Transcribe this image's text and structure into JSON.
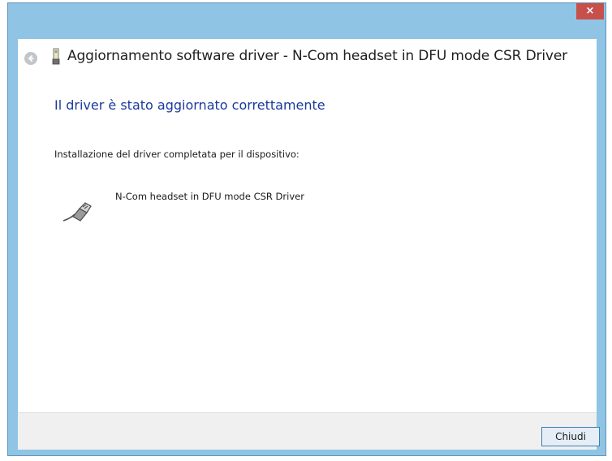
{
  "window": {
    "title": "Aggiornamento software driver - N-Com headset in DFU mode CSR Driver",
    "close_glyph": "×",
    "accent_color": "#8fc4e4"
  },
  "content": {
    "main_instruction": "Il driver è stato aggiornato correttamente",
    "body_text": "Installazione del driver completata per il dispositivo:",
    "device_name": "N-Com headset in DFU mode CSR Driver",
    "device_icon": "usb-plug-icon"
  },
  "footer": {
    "close_button_label": "Chiudi"
  }
}
